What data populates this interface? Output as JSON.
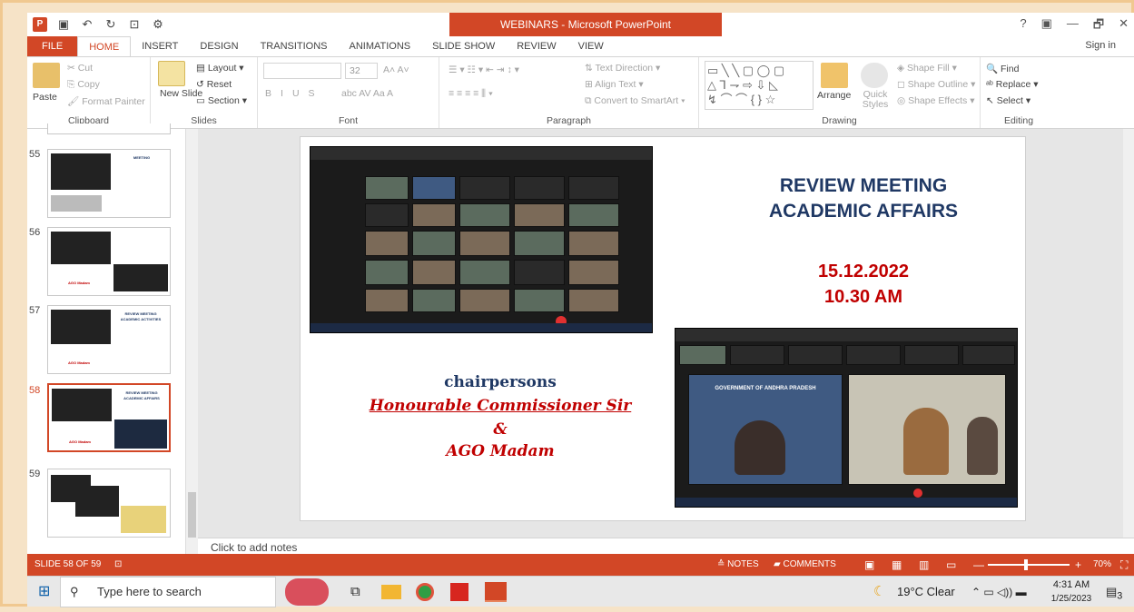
{
  "window": {
    "title": "WEBINARS - Microsoft PowerPoint",
    "controls": [
      "?",
      "▣",
      "—",
      "🗗",
      "✕"
    ],
    "sign_in": "Sign in"
  },
  "ribbon_tabs": [
    "FILE",
    "HOME",
    "INSERT",
    "DESIGN",
    "TRANSITIONS",
    "ANIMATIONS",
    "SLIDE SHOW",
    "REVIEW",
    "VIEW"
  ],
  "active_tab": "HOME",
  "ribbon": {
    "clipboard": {
      "label": "Clipboard",
      "paste": "Paste",
      "cut": "Cut",
      "copy": "Copy",
      "format_painter": "Format Painter"
    },
    "slides": {
      "label": "Slides",
      "new_slide": "New Slide",
      "layout": "Layout",
      "reset": "Reset",
      "section": "Section"
    },
    "font": {
      "label": "Font",
      "size": "32",
      "bold": "B",
      "italic": "I",
      "underline": "U",
      "shadow": "S",
      "strike": "abc",
      "spacing": "AV",
      "case": "Aa",
      "color": "A"
    },
    "paragraph": {
      "label": "Paragraph",
      "text_direction": "Text Direction",
      "align_text": "Align Text",
      "convert_smartart": "Convert to SmartArt"
    },
    "drawing": {
      "label": "Drawing",
      "arrange": "Arrange",
      "quick_styles": "Quick Styles",
      "shape_fill": "Shape Fill",
      "shape_outline": "Shape Outline",
      "shape_effects": "Shape Effects"
    },
    "editing": {
      "label": "Editing",
      "find": "Find",
      "replace": "Replace",
      "select": "Select"
    }
  },
  "thumbnails": [
    {
      "num": "55",
      "title": "MEETING",
      "line2": "",
      "sub": ""
    },
    {
      "num": "56",
      "title": "",
      "line2": "",
      "sub": "AGO Madam"
    },
    {
      "num": "57",
      "title": "REVIEW MEETING",
      "line2": "ACADEMIC ACTIVITIES",
      "sub": "AGO Madam"
    },
    {
      "num": "58",
      "title": "REVIEW MEETING",
      "line2": "ACADEMIC AFFAIRS",
      "sub": "AGO Madam"
    },
    {
      "num": "59",
      "title": "",
      "line2": "",
      "sub": ""
    }
  ],
  "slide": {
    "title_line1": "REVIEW MEETING",
    "title_line2": "ACADEMIC AFFAIRS",
    "date": "15.12.2022",
    "time": "10.30 AM",
    "chair_heading": "chairpersons",
    "chair_line1": "Honourable Commissioner Sir",
    "chair_amp": "&",
    "chair_line2": "AGO Madam",
    "banner": "GOVERNMENT OF ANDHRA PRADESH"
  },
  "notes_placeholder": "Click to add notes",
  "statusbar": {
    "slide_count": "SLIDE 58 OF 59",
    "notes": "NOTES",
    "comments": "COMMENTS",
    "zoom": "70%"
  },
  "taskbar": {
    "search_placeholder": "Type here to search",
    "weather": "19°C Clear",
    "time": "4:31 AM",
    "date": "1/25/2023",
    "notification_count": "3"
  },
  "colors": {
    "accent": "#d24726",
    "title_blue": "#1f3864",
    "title_red": "#c00000"
  }
}
